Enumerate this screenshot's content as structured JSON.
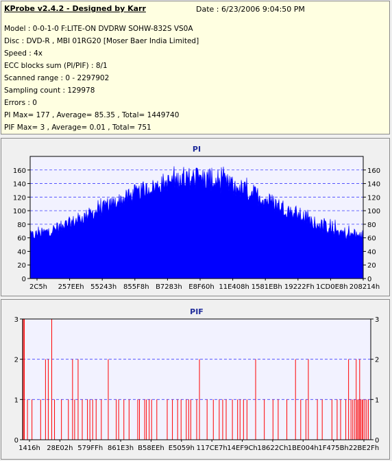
{
  "header": {
    "title": "KProbe v2.4.2 - Designed by Karr",
    "date": "Date : 6/23/2006 9:04:50 PM"
  },
  "info_lines": [
    "Model : 0-0-1-0 F:LITE-ON DVDRW SOHW-832S  VS0A",
    "Disc : DVD-R , MBI 01RG20   [Moser Baer India Limited]",
    "Speed : 4x",
    "ECC blocks sum (PI/PIF) : 8/1",
    "Scanned range : 0 - 2297902",
    "Sampling count : 129978",
    "Errors : 0",
    "PI Max= 177 , Average= 85.35 , Total= 1449740",
    "PIF Max= 3 , Average= 0.01 , Total= 751"
  ],
  "colors": {
    "info_bg": "#ffffe1",
    "plot_bg": "#f2f2ff",
    "pi_fill": "#0000ff",
    "pif_line": "#ff0000",
    "grid": "#3c3cff",
    "title": "#1e2b9a"
  },
  "chart_data": [
    {
      "type": "area",
      "title": "PI",
      "ylim": [
        0,
        180
      ],
      "y_ticks": [
        0,
        20,
        40,
        60,
        80,
        100,
        120,
        140,
        160
      ],
      "x_tick_labels": [
        "2C5h",
        "257EEh",
        "55243h",
        "855F8h",
        "B7283h",
        "E8F60h",
        "11E408h",
        "1581EBh",
        "19222Fh",
        "1CD0E8h",
        "208214h"
      ],
      "grid": true,
      "profile_x": [
        0,
        0.05,
        0.1,
        0.15,
        0.2,
        0.25,
        0.3,
        0.35,
        0.4,
        0.45,
        0.5,
        0.55,
        0.6,
        0.65,
        0.7,
        0.75,
        0.8,
        0.85,
        0.9,
        0.95,
        1.0
      ],
      "profile_avg": [
        60,
        66,
        74,
        85,
        96,
        108,
        118,
        128,
        136,
        142,
        143,
        140,
        133,
        124,
        114,
        103,
        92,
        80,
        70,
        62,
        58
      ],
      "profile_max": [
        75,
        82,
        92,
        104,
        116,
        128,
        140,
        150,
        160,
        170,
        177,
        172,
        162,
        152,
        140,
        127,
        114,
        100,
        90,
        82,
        78
      ]
    },
    {
      "type": "bar",
      "title": "PIF",
      "ylim": [
        0,
        3
      ],
      "y_ticks": [
        0,
        1,
        2,
        3
      ],
      "x_tick_labels": [
        "1416h",
        "28E02h",
        "579FFh",
        "861E3h",
        "B58EEh",
        "E5059h",
        "117CE7h",
        "14EF9Ch",
        "18622Ch",
        "1BE004h",
        "1F475Bh",
        "22BE2Fh"
      ],
      "grid": true,
      "spikes": [
        {
          "x": 0.0,
          "v": 3
        },
        {
          "x": 0.003,
          "v": 3
        },
        {
          "x": 0.012,
          "v": 1
        },
        {
          "x": 0.025,
          "v": 1
        },
        {
          "x": 0.05,
          "v": 1
        },
        {
          "x": 0.064,
          "v": 2
        },
        {
          "x": 0.072,
          "v": 2
        },
        {
          "x": 0.082,
          "v": 3
        },
        {
          "x": 0.09,
          "v": 1
        },
        {
          "x": 0.11,
          "v": 1
        },
        {
          "x": 0.13,
          "v": 1
        },
        {
          "x": 0.142,
          "v": 2
        },
        {
          "x": 0.148,
          "v": 1
        },
        {
          "x": 0.158,
          "v": 2
        },
        {
          "x": 0.17,
          "v": 1
        },
        {
          "x": 0.185,
          "v": 1
        },
        {
          "x": 0.192,
          "v": 1
        },
        {
          "x": 0.2,
          "v": 1
        },
        {
          "x": 0.21,
          "v": 1
        },
        {
          "x": 0.225,
          "v": 1
        },
        {
          "x": 0.245,
          "v": 2
        },
        {
          "x": 0.268,
          "v": 1
        },
        {
          "x": 0.275,
          "v": 1
        },
        {
          "x": 0.29,
          "v": 1
        },
        {
          "x": 0.305,
          "v": 1
        },
        {
          "x": 0.33,
          "v": 1
        },
        {
          "x": 0.335,
          "v": 1
        },
        {
          "x": 0.35,
          "v": 1
        },
        {
          "x": 0.355,
          "v": 1
        },
        {
          "x": 0.363,
          "v": 1
        },
        {
          "x": 0.37,
          "v": 1
        },
        {
          "x": 0.385,
          "v": 1
        },
        {
          "x": 0.415,
          "v": 1
        },
        {
          "x": 0.43,
          "v": 1
        },
        {
          "x": 0.445,
          "v": 1
        },
        {
          "x": 0.455,
          "v": 1
        },
        {
          "x": 0.47,
          "v": 1
        },
        {
          "x": 0.477,
          "v": 1
        },
        {
          "x": 0.483,
          "v": 1
        },
        {
          "x": 0.5,
          "v": 1
        },
        {
          "x": 0.508,
          "v": 2
        },
        {
          "x": 0.53,
          "v": 1
        },
        {
          "x": 0.548,
          "v": 1
        },
        {
          "x": 0.565,
          "v": 1
        },
        {
          "x": 0.575,
          "v": 1
        },
        {
          "x": 0.585,
          "v": 1
        },
        {
          "x": 0.603,
          "v": 1
        },
        {
          "x": 0.618,
          "v": 1
        },
        {
          "x": 0.625,
          "v": 1
        },
        {
          "x": 0.635,
          "v": 1
        },
        {
          "x": 0.645,
          "v": 1
        },
        {
          "x": 0.67,
          "v": 2
        },
        {
          "x": 0.695,
          "v": 1
        },
        {
          "x": 0.72,
          "v": 1
        },
        {
          "x": 0.735,
          "v": 1
        },
        {
          "x": 0.76,
          "v": 1
        },
        {
          "x": 0.785,
          "v": 2
        },
        {
          "x": 0.8,
          "v": 1
        },
        {
          "x": 0.815,
          "v": 1
        },
        {
          "x": 0.822,
          "v": 2
        },
        {
          "x": 0.848,
          "v": 1
        },
        {
          "x": 0.862,
          "v": 1
        },
        {
          "x": 0.89,
          "v": 1
        },
        {
          "x": 0.905,
          "v": 1
        },
        {
          "x": 0.915,
          "v": 1
        },
        {
          "x": 0.93,
          "v": 1
        },
        {
          "x": 0.938,
          "v": 2
        },
        {
          "x": 0.945,
          "v": 1
        },
        {
          "x": 0.95,
          "v": 1
        },
        {
          "x": 0.955,
          "v": 1
        },
        {
          "x": 0.96,
          "v": 2
        },
        {
          "x": 0.963,
          "v": 1
        },
        {
          "x": 0.967,
          "v": 1
        },
        {
          "x": 0.97,
          "v": 2
        },
        {
          "x": 0.973,
          "v": 1
        },
        {
          "x": 0.977,
          "v": 1
        },
        {
          "x": 0.98,
          "v": 1
        },
        {
          "x": 0.985,
          "v": 1
        },
        {
          "x": 0.99,
          "v": 1
        },
        {
          "x": 0.995,
          "v": 1
        }
      ]
    }
  ]
}
